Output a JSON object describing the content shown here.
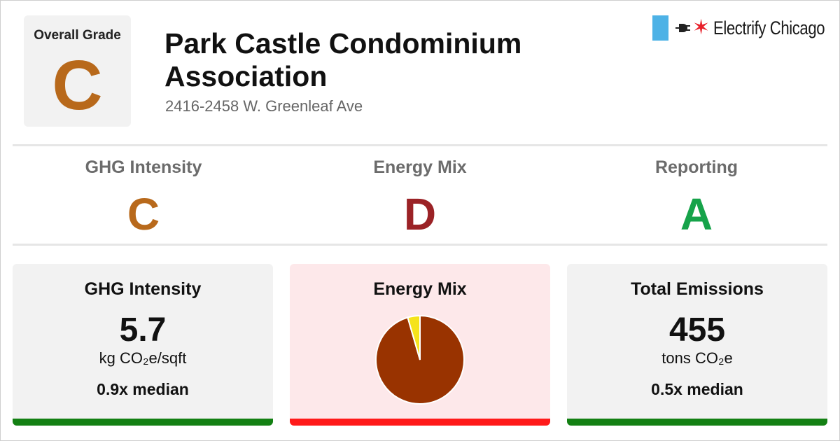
{
  "header": {
    "overall_label": "Overall Grade",
    "overall_grade": "C",
    "overall_color": "#b8691b",
    "building_name": "Park Castle Condominium Association",
    "address": "2416-2458 W. Greenleaf Ave"
  },
  "logo": {
    "text": "Electrify Chicago",
    "flag_color": "#4db2e6",
    "star_color": "#e8202a",
    "plug_icon": "plug-icon",
    "star_icon": "red-star-icon"
  },
  "grades": [
    {
      "label": "GHG Intensity",
      "grade": "C",
      "color": "#b8691b"
    },
    {
      "label": "Energy Mix",
      "grade": "D",
      "color": "#9b2226"
    },
    {
      "label": "Reporting",
      "grade": "A",
      "color": "#16a34a"
    }
  ],
  "cards": {
    "ghg": {
      "title": "GHG Intensity",
      "value": "5.7",
      "unit": "kg CO₂e/sqft",
      "median": "0.9x median",
      "bg": "#f2f2f2",
      "bar_color": "#138013"
    },
    "mix": {
      "title": "Energy Mix",
      "bg": "#fde8ea",
      "bar_color": "#ff1a1a"
    },
    "total": {
      "title": "Total Emissions",
      "value": "455",
      "unit": "tons CO₂e",
      "median": "0.5x median",
      "bg": "#f2f2f2",
      "bar_color": "#138013"
    }
  },
  "chart_data": {
    "type": "pie",
    "title": "Energy Mix",
    "slices": [
      {
        "value": 95.5,
        "color": "#993300"
      },
      {
        "value": 4.5,
        "color": "#f5e31a"
      }
    ]
  }
}
